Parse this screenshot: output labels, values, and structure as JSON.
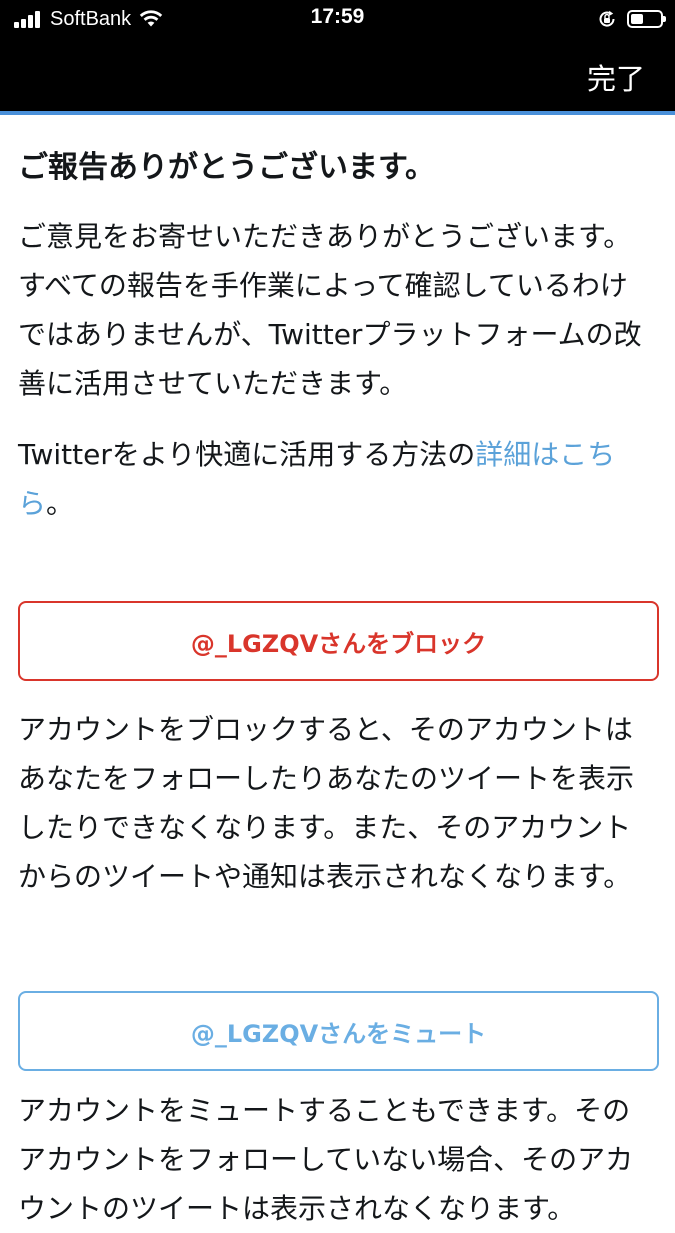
{
  "status_bar": {
    "carrier": "SoftBank",
    "time": "17:59",
    "icons": [
      "signal-icon",
      "wifi-icon",
      "orientation-lock-icon",
      "battery-icon"
    ]
  },
  "nav": {
    "done_label": "完了"
  },
  "report": {
    "heading": "ご報告ありがとうございます。",
    "thanks_text": "ご意見をお寄せいただきありがとうございます。すべての報告を手作業によって確認しているわけではありませんが、Twitterプラットフォームの改善に活用させていただきます。",
    "learn_more_prefix": "Twitterをより快適に活用する方法の",
    "learn_more_link": "詳細はこちら",
    "learn_more_suffix": "。"
  },
  "block": {
    "button_label": "@_LGZQVさんをブロック",
    "description": "アカウントをブロックすると、そのアカウントはあなたをフォローしたりあなたのツイートを表示したりできなくなります。また、そのアカウントからのツイートや通知は表示されなくなります。"
  },
  "mute": {
    "button_label": "@_LGZQVさんをミュート",
    "description": "アカウントをミュートすることもできます。そのアカウントをフォローしていない場合、そのアカウントのツイートは表示されなくなります。"
  },
  "colors": {
    "block_red": "#d9352b",
    "mute_blue": "#6aaee3",
    "link_blue": "#5ba2d9",
    "nav_underline": "#4a90d9"
  }
}
